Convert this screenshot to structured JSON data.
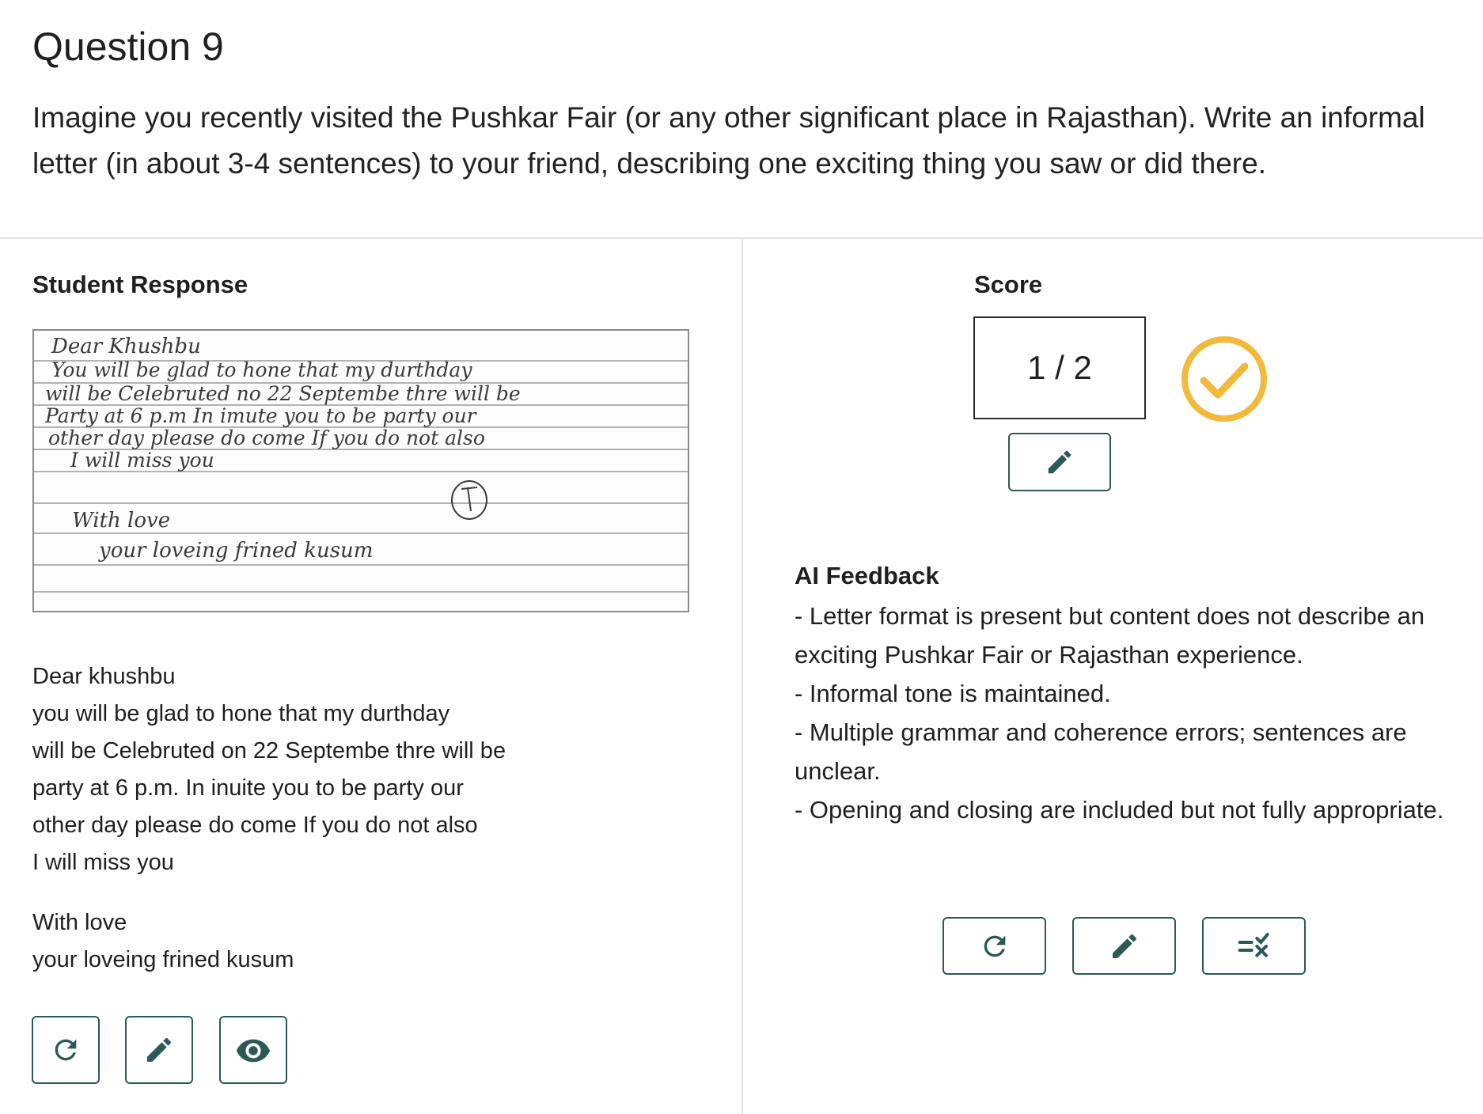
{
  "question": {
    "title": "Question 9",
    "text": "Imagine you recently visited the Pushkar Fair (or any other significant place in Rajasthan). Write an informal letter (in about 3-4 sentences) to your friend, describing one exciting thing you saw or did there."
  },
  "student_response": {
    "heading": "Student Response",
    "handwritten_lines": [
      "Dear Khushbu",
      "You will be glad to hone that my durthday",
      "will be Celebruted no 22 Septembe thre will be",
      "Party at 6 p.m In imute you to be party our",
      "other day please do come If you do not also",
      "I will miss you",
      "With love",
      "your loveing frined kusum"
    ],
    "transcript_lines": [
      "Dear khushbu",
      "you will be glad to hone that my durthday",
      "will be Celebruted on 22 Septembe thre will be",
      "party at 6 p.m. In inuite you to be party our",
      "other day please do come If you do not also",
      "I will miss you"
    ],
    "closing_lines": [
      "With love",
      "your loveing frined kusum"
    ],
    "buttons": [
      {
        "icon": "refresh-icon"
      },
      {
        "icon": "pencil-icon"
      },
      {
        "icon": "eye-icon"
      }
    ]
  },
  "score": {
    "heading": "Score",
    "value": "1 / 2",
    "status_icon": "check-circle-icon",
    "status_color": "#f2b93b",
    "edit_icon": "pencil-icon"
  },
  "ai_feedback": {
    "heading": "AI Feedback",
    "lines": [
      "- Letter format is present but content does not describe an exciting Pushkar Fair or Rajasthan experience.",
      "- Informal tone is maintained.",
      "- Multiple grammar and coherence errors; sentences are unclear.",
      "- Opening and closing are included but not fully appropriate."
    ],
    "buttons": [
      {
        "icon": "refresh-icon"
      },
      {
        "icon": "pencil-icon"
      },
      {
        "icon": "list-check-icon"
      }
    ]
  },
  "colors": {
    "accent": "#2b5a55",
    "badge": "#f2b93b"
  }
}
